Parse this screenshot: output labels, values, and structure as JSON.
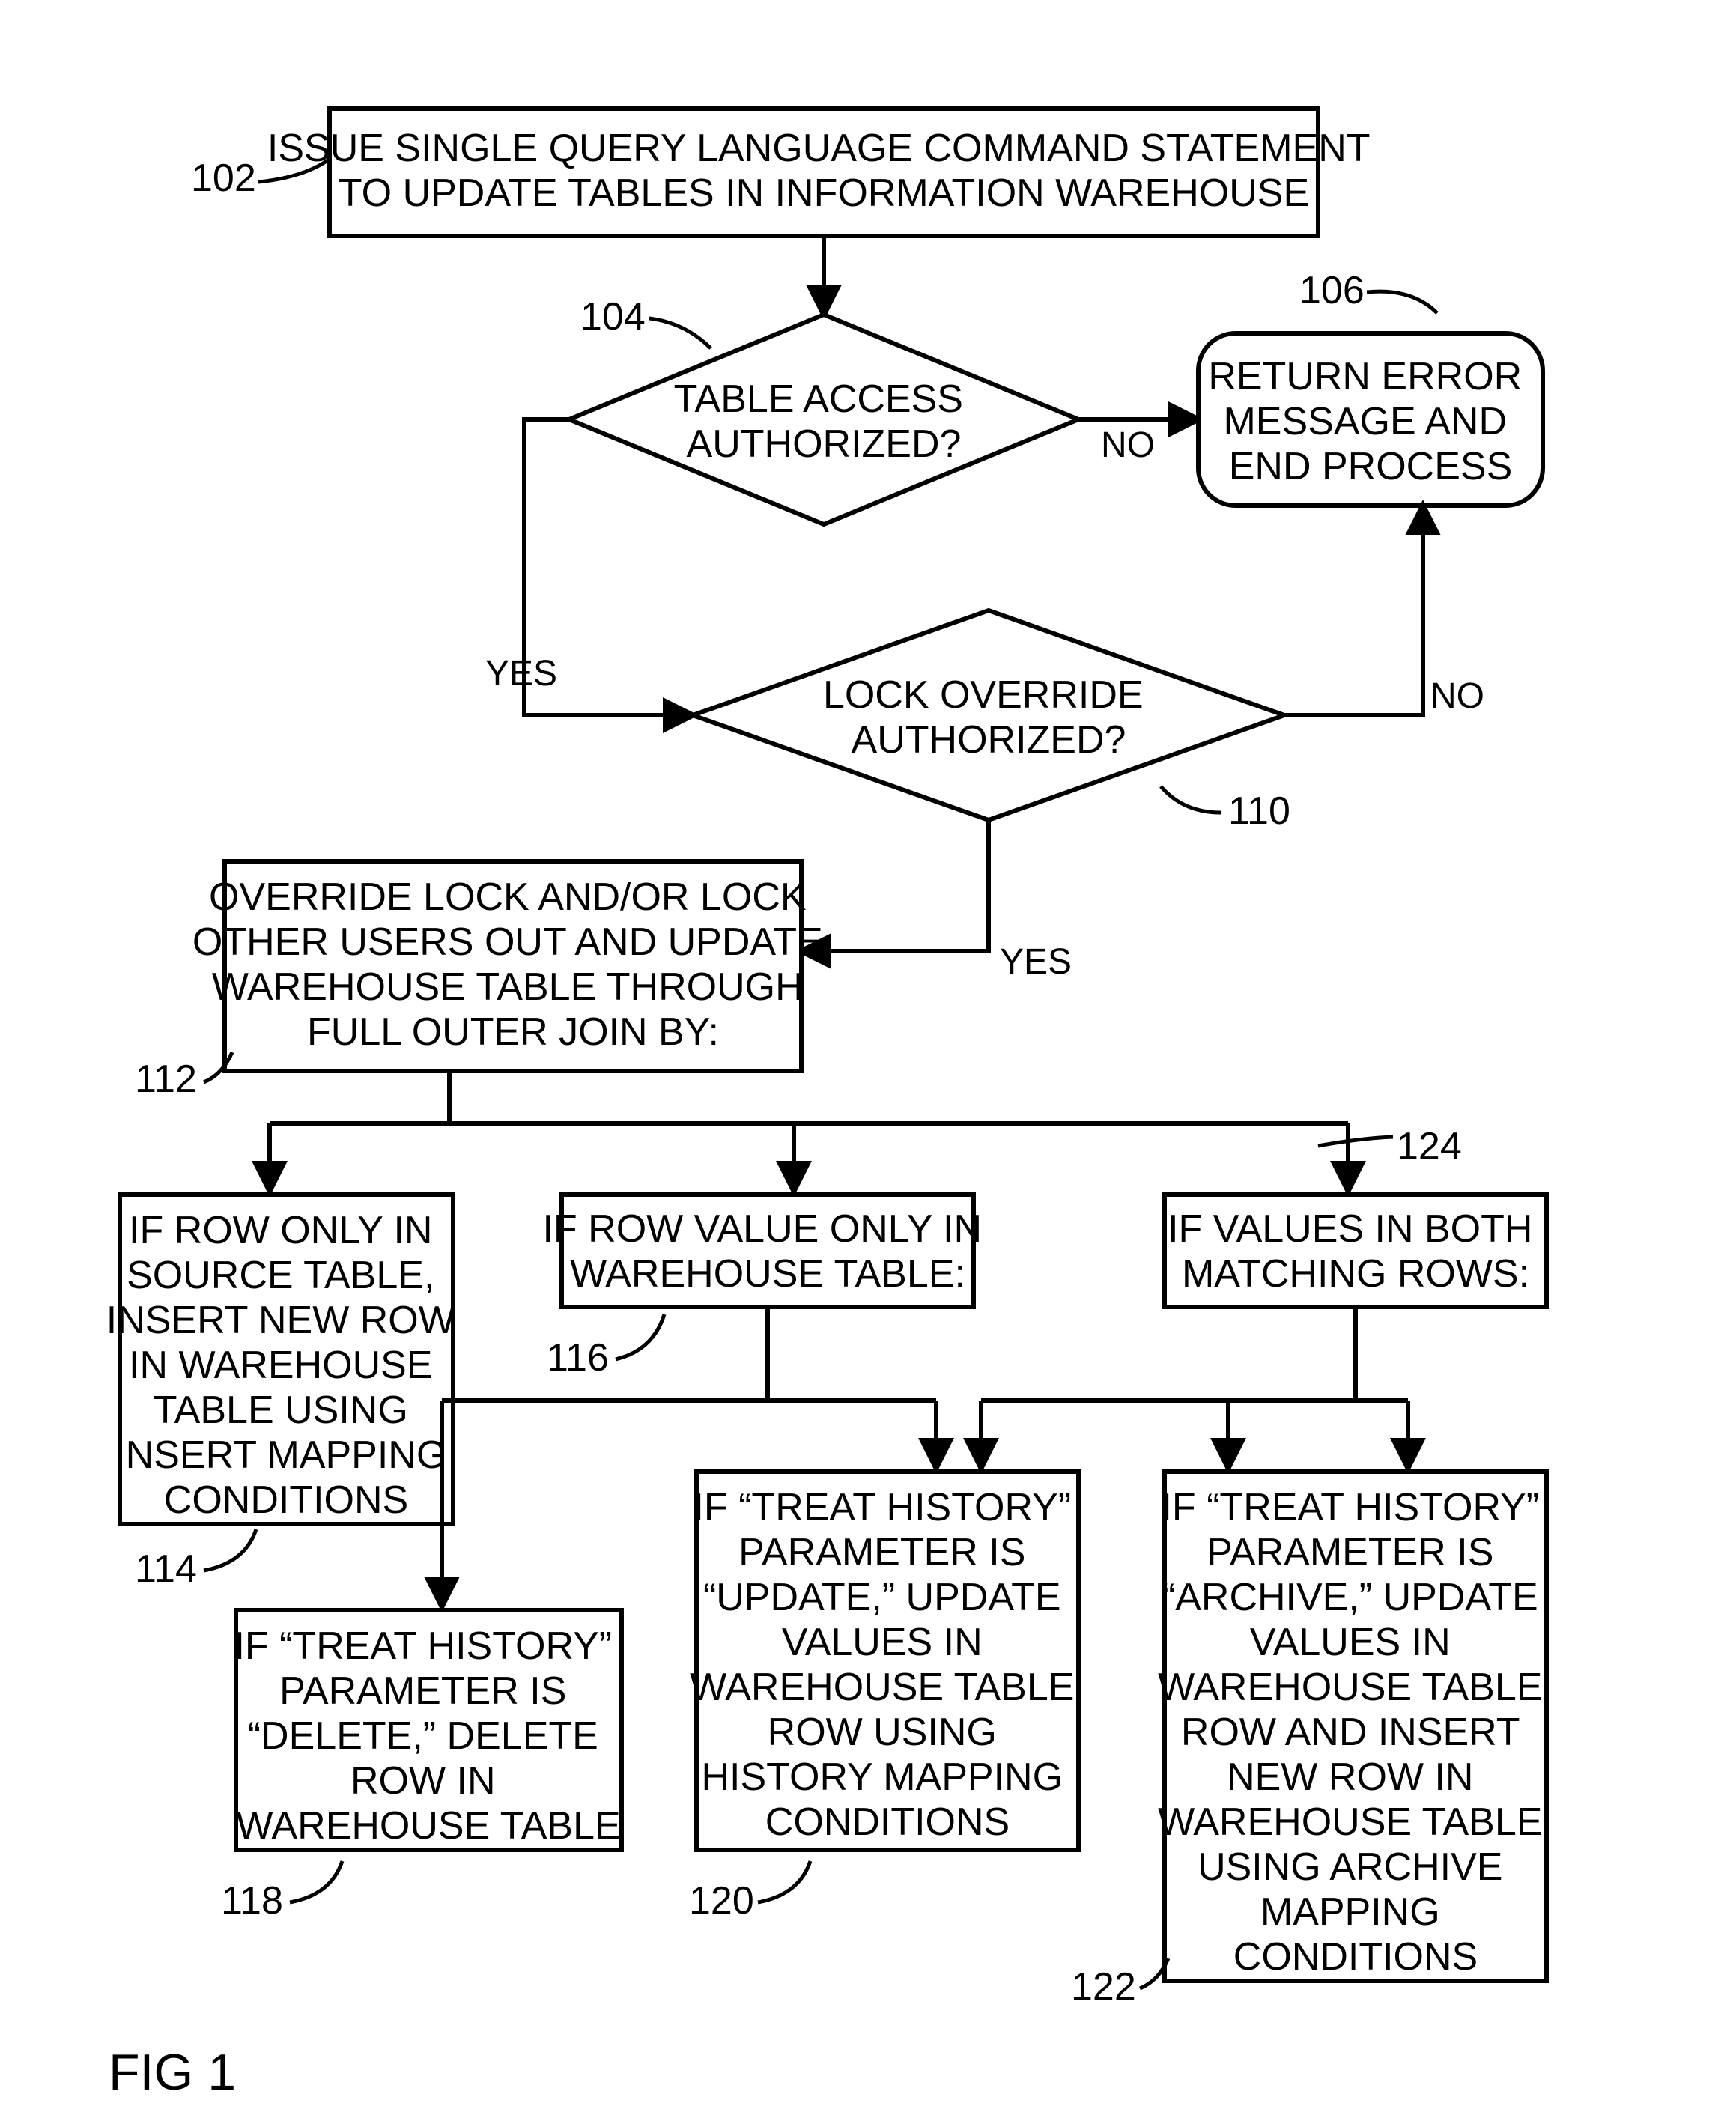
{
  "figure_label": "FIG 1",
  "refs": {
    "n102": "102",
    "n104": "104",
    "n106": "106",
    "n110": "110",
    "n112": "112",
    "n114": "114",
    "n116": "116",
    "n118": "118",
    "n120": "120",
    "n122": "122",
    "n124": "124"
  },
  "labels": {
    "yes": "YES",
    "no": "NO"
  },
  "nodes": {
    "b102": [
      "ISSUE SINGLE QUERY LANGUAGE COMMAND STATEMENT",
      "TO UPDATE TABLES IN INFORMATION WAREHOUSE"
    ],
    "d104": [
      "TABLE ACCESS",
      "AUTHORIZED?"
    ],
    "r106": [
      "RETURN ERROR",
      "MESSAGE AND",
      "END PROCESS"
    ],
    "d110": [
      "LOCK OVERRIDE",
      "AUTHORIZED?"
    ],
    "b112": [
      "OVERRIDE LOCK AND/OR LOCK",
      "OTHER USERS OUT AND UPDATE",
      "WAREHOUSE TABLE THROUGH",
      "FULL OUTER JOIN BY:"
    ],
    "b114": [
      "IF ROW ONLY IN",
      "SOURCE TABLE,",
      "INSERT NEW ROW",
      "IN WAREHOUSE",
      "TABLE USING",
      "INSERT MAPPING",
      "CONDITIONS"
    ],
    "b116": [
      "IF ROW VALUE ONLY IN",
      "WAREHOUSE TABLE:"
    ],
    "b118": [
      "IF “TREAT HISTORY”",
      "PARAMETER IS",
      "“DELETE,” DELETE",
      "ROW IN",
      "WAREHOUSE TABLE"
    ],
    "b120": [
      "IF “TREAT HISTORY”",
      "PARAMETER IS",
      "“UPDATE,” UPDATE",
      "VALUES IN",
      "WAREHOUSE TABLE",
      "ROW USING",
      "HISTORY MAPPING",
      "CONDITIONS"
    ],
    "b122": [
      "IF “TREAT HISTORY”",
      "PARAMETER IS",
      "“ARCHIVE,” UPDATE",
      "VALUES IN",
      "WAREHOUSE TABLE",
      "ROW AND INSERT",
      "NEW ROW IN",
      "WAREHOUSE TABLE",
      "USING ARCHIVE",
      "MAPPING",
      "CONDITIONS"
    ],
    "b124": [
      "IF VALUES IN BOTH",
      "MATCHING ROWS:"
    ]
  }
}
